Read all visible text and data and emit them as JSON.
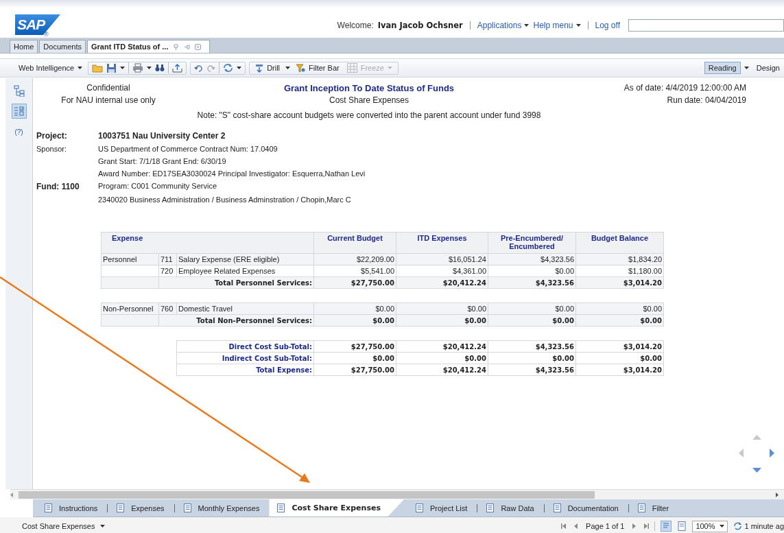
{
  "header": {
    "logo": "SAP",
    "logo_mark": "®",
    "welcome_label": "Welcome:",
    "user_name": "Ivan Jacob Ochsner",
    "links": [
      {
        "label": "Applications",
        "dropdown": true
      },
      {
        "label": "Help menu",
        "dropdown": true
      },
      {
        "label": "Log off",
        "dropdown": false
      }
    ]
  },
  "doc_tabs": [
    {
      "label": "Home",
      "selected": false
    },
    {
      "label": "Documents",
      "selected": false
    },
    {
      "label": "Grant ITD Status of ...",
      "selected": true
    }
  ],
  "toolbar": {
    "app_menu": "Web Intelligence",
    "drill": "Drill",
    "filter_bar": "Filter Bar",
    "freeze": {
      "label": "Freeze",
      "disabled": true
    },
    "modes": [
      {
        "label": "Reading",
        "selected": true
      },
      {
        "label": "Design",
        "selected": false
      }
    ]
  },
  "sidebar": {
    "items": [
      {
        "selected": false
      },
      {
        "selected": true
      },
      {
        "selected": false,
        "label": "(?)"
      }
    ]
  },
  "report": {
    "confidential": "Confidential",
    "internal": "For NAU internal use only",
    "title": "Grant Inception To Date Status of Funds",
    "subtitle": "Cost Share Expenses",
    "note": "Note: \"S\" cost-share account budgets were converted into the parent account under fund 3998",
    "as_of": "As of date:  4/4/2019 12:00:00 AM",
    "run_date": "Run date:  04/04/2019",
    "info": [
      {
        "label": "Project:",
        "value": "1003751  Nau University Center 2",
        "strong": true
      },
      {
        "label": "Sponsor:",
        "value": "US Department of Commerce    Contract Num: 17.0409",
        "strong": false
      },
      {
        "value": "Grant Start: 7/1/18  Grant End: 6/30/19",
        "strong": false
      },
      {
        "value": "Award Number: ED17SEA3030024  Principal Investigator: Esquerra,Nathan Levi",
        "strong": false
      },
      {
        "label": "Fund: 1100",
        "value": "Program: C001 Community Service",
        "strong": false,
        "label_strong": true
      },
      {
        "value": "2340020  Business Administration / Business Adminstration / Chopin,Marc C",
        "strong": false
      }
    ],
    "table": {
      "columns": [
        "Expense",
        "Current Budget",
        "ITD Expenses",
        "Pre-Encumbered/ Encumbered",
        "Budget Balance"
      ],
      "sections": [
        {
          "rows": [
            {
              "kind": "detail",
              "group": "Personnel",
              "code": "711",
              "description": "Salary Expense (ERE eligible)",
              "values": [
                "$22,209.00",
                "$16,051.24",
                "$4,323.56",
                "$1,834.20"
              ]
            },
            {
              "kind": "detail",
              "code": "720",
              "description": "Employee Related Expenses",
              "values": [
                "$5,541.00",
                "$4,361.00",
                "$0.00",
                "$1,180.00"
              ]
            },
            {
              "kind": "total",
              "label": "Total Personnel Services:",
              "values": [
                "$27,750.00",
                "$20,412.24",
                "$4,323.56",
                "$3,014.20"
              ]
            }
          ]
        },
        {
          "rows": [
            {
              "kind": "detail",
              "group": "Non-Personnel",
              "code": "760",
              "description": "Domestic Travel",
              "values": [
                "$0.00",
                "$0.00",
                "$0.00",
                "$0.00"
              ]
            },
            {
              "kind": "total",
              "label": "Total Non-Personnel Services:",
              "values": [
                "$0.00",
                "$0.00",
                "$0.00",
                "$0.00"
              ]
            }
          ]
        }
      ],
      "summary": [
        {
          "label": "Direct Cost Sub-Total:",
          "values": [
            "$27,750.00",
            "$20,412.24",
            "$4,323.56",
            "$3,014.20"
          ]
        },
        {
          "label": "Indirect Cost Sub-Total:",
          "values": [
            "$0.00",
            "$0.00",
            "$0.00",
            "$0.00"
          ]
        },
        {
          "label": "Total Expense:",
          "values": [
            "$27,750.00",
            "$20,412.24",
            "$4,323.56",
            "$3,014.20"
          ]
        }
      ]
    }
  },
  "sheet_tabs": [
    {
      "label": "Instructions",
      "selected": false
    },
    {
      "label": "Expenses",
      "selected": false
    },
    {
      "label": "Monthly Expenses",
      "selected": false
    },
    {
      "label": "Cost Share Expenses",
      "selected": true
    },
    {
      "label": "Project List",
      "selected": false
    },
    {
      "label": "Raw Data",
      "selected": false
    },
    {
      "label": "Documentation",
      "selected": false
    },
    {
      "label": "Filter",
      "selected": false
    }
  ],
  "status_bar": {
    "report_menu": "Cost Share Expenses",
    "page": "Page 1 of 1",
    "zoom": "100%",
    "refresh": "1 minute ag"
  }
}
